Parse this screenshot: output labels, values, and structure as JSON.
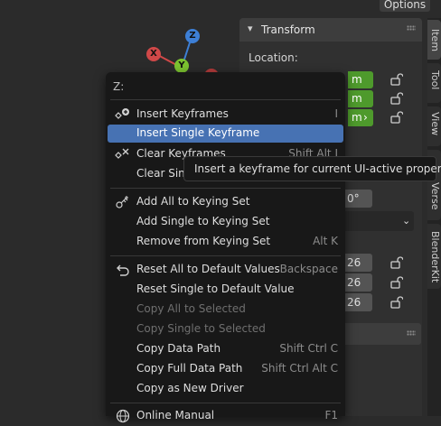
{
  "header": {
    "options_label": "Options"
  },
  "gizmo": {
    "z_label": "Z",
    "x_label": "X",
    "y_label": "Y"
  },
  "npanel": {
    "transform_title": "Transform",
    "location_label": "Location:",
    "location_units": [
      "m",
      "m",
      "m"
    ],
    "rotation_value": "0°",
    "scale_values": [
      "26",
      "26",
      "26"
    ]
  },
  "tabs": [
    "Item",
    "Tool",
    "View",
    "Verse",
    "BlenderKit"
  ],
  "menu": {
    "title": "Z:",
    "items": [
      {
        "label": "Insert Keyframes",
        "shortcut": "I",
        "icon": "keyframe-add-icon",
        "disabled": false,
        "highlight": false
      },
      {
        "label": "Insert Single Keyframe",
        "shortcut": "",
        "icon": "",
        "disabled": false,
        "highlight": true
      },
      {
        "label": "Clear Keyframes",
        "shortcut": "Shift Alt I",
        "icon": "keyframe-clear-icon",
        "disabled": false,
        "highlight": false
      },
      {
        "label": "Clear Single Keyframe",
        "shortcut": "",
        "icon": "",
        "disabled": false,
        "highlight": false
      },
      {
        "label": "Add All to Keying Set",
        "shortcut": "",
        "icon": "keying-set-icon",
        "disabled": false,
        "highlight": false
      },
      {
        "label": "Add Single to Keying Set",
        "shortcut": "",
        "icon": "",
        "disabled": false,
        "highlight": false
      },
      {
        "label": "Remove from Keying Set",
        "shortcut": "Alt K",
        "icon": "",
        "disabled": false,
        "highlight": false
      },
      {
        "label": "Reset All to Default Values",
        "shortcut": "Backspace",
        "icon": "undo-arrow-icon",
        "disabled": false,
        "highlight": false
      },
      {
        "label": "Reset Single to Default Value",
        "shortcut": "",
        "icon": "",
        "disabled": false,
        "highlight": false
      },
      {
        "label": "Copy All to Selected",
        "shortcut": "",
        "icon": "",
        "disabled": true,
        "highlight": false
      },
      {
        "label": "Copy Single to Selected",
        "shortcut": "",
        "icon": "",
        "disabled": true,
        "highlight": false
      },
      {
        "label": "Copy Data Path",
        "shortcut": "Shift Ctrl C",
        "icon": "",
        "disabled": false,
        "highlight": false
      },
      {
        "label": "Copy Full Data Path",
        "shortcut": "Shift Ctrl Alt C",
        "icon": "",
        "disabled": false,
        "highlight": false
      },
      {
        "label": "Copy as New Driver",
        "shortcut": "",
        "icon": "",
        "disabled": false,
        "highlight": false
      },
      {
        "label": "Online Manual",
        "shortcut": "F1",
        "icon": "globe-icon",
        "disabled": false,
        "highlight": false
      }
    ]
  },
  "tooltip": {
    "text": "Insert a keyframe for current UI-active property."
  },
  "colors": {
    "highlight": "#4772b3",
    "location_green": "#4e9a2c",
    "menu_bg": "#181818"
  }
}
